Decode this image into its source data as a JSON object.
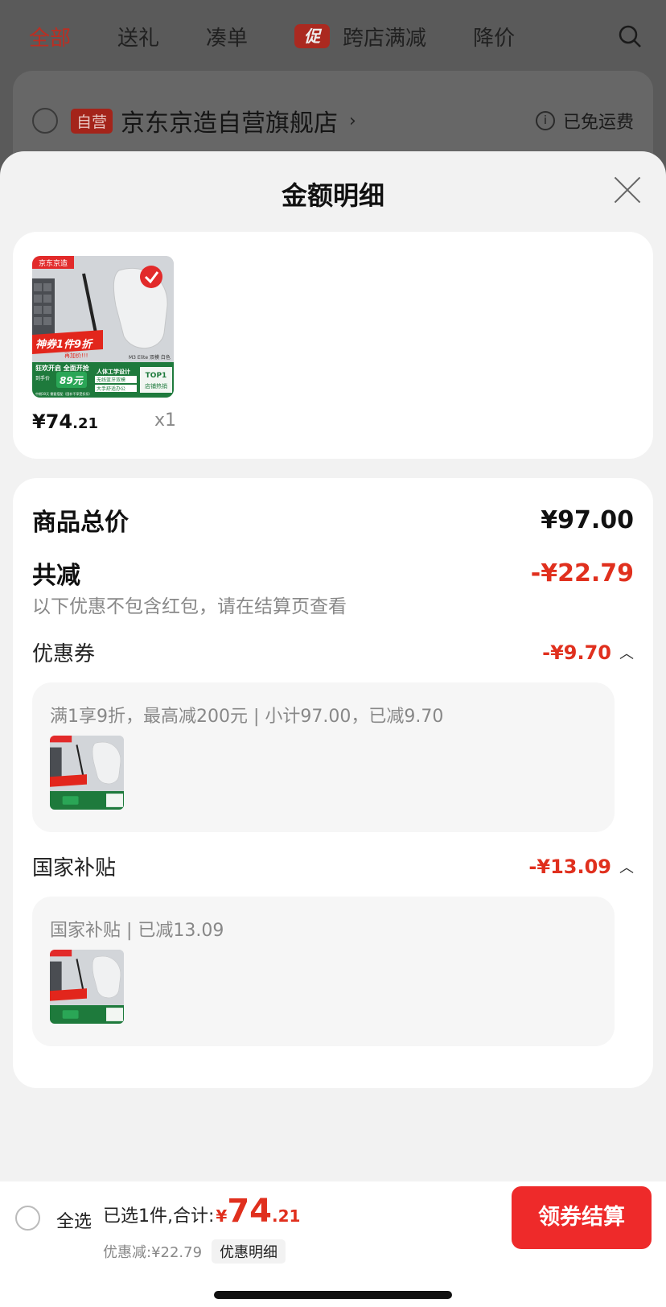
{
  "background": {
    "tabs": [
      "全部",
      "送礼",
      "凑单",
      "跨店满减",
      "降价"
    ],
    "promo_badge": "促",
    "store": {
      "badge": "自营",
      "name": "京东京造自营旗舰店",
      "arrow": "›",
      "shipping": "已免运费"
    }
  },
  "sheet": {
    "title": "金额明细",
    "product": {
      "price_int": "¥74",
      "price_dec": ".21",
      "qty": "x1",
      "image_texts": {
        "brand": "京东京造",
        "promo": "神券1件9折",
        "promo_sub": "再加价!!!",
        "model": "M3 Elite 双模 白色",
        "line1": "狂欢开启 全面开抢",
        "line2": "到手价",
        "price": "89元",
        "feature1": "人体工学设计",
        "feature2": "无线蓝牙双模",
        "feature3": "大手舒适办公",
        "top": "TOP1",
        "top_sub": "店铺热销",
        "footnote": "中期30天 需要搭配（国补不享受折扣）"
      }
    },
    "total_label": "商品总价",
    "total_value": "¥97.00",
    "reduced_label": "共减",
    "reduced_value": "-¥22.79",
    "note": "以下优惠不包含红包，请在结算页查看",
    "coupon": {
      "label": "优惠券",
      "value": "-¥9.70",
      "desc": "满1享9折，最高减200元 | 小计97.00，已减9.70"
    },
    "subsidy": {
      "label": "国家补贴",
      "value": "-¥13.09",
      "desc": "国家补贴 | 已减13.09"
    }
  },
  "bottom": {
    "select_all": "全选",
    "summary": "已选1件,合计:",
    "yen": "¥",
    "total_int": "74",
    "total_dec": ".21",
    "discount": "优惠减:¥22.79",
    "detail_link": "优惠明细",
    "checkout": "领券结算"
  },
  "icons": [
    "search-icon",
    "info-icon",
    "close-icon",
    "chevron-up-icon",
    "radio-icon"
  ],
  "colors": {
    "accent": "#e0301e",
    "checkout": "#ee2a2a",
    "promo": "#b4241a"
  }
}
